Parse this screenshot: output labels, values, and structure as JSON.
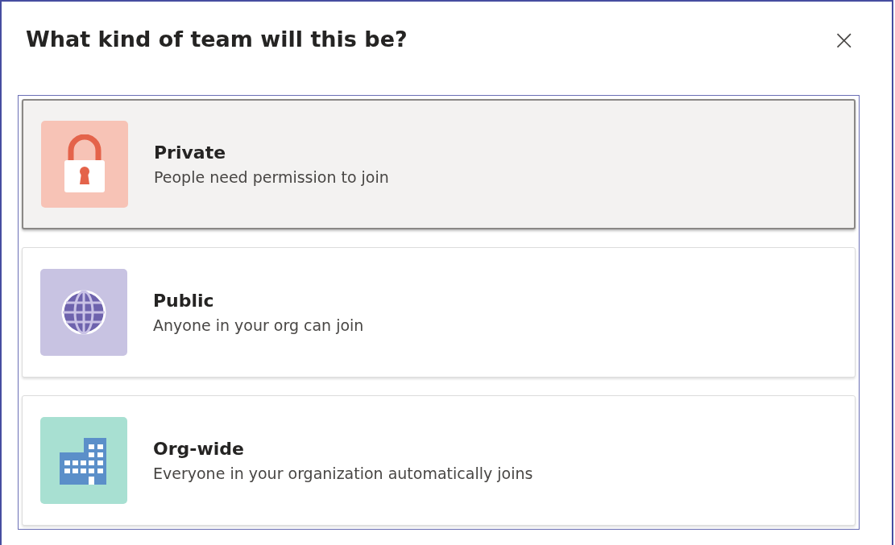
{
  "dialog": {
    "title": "What kind of team will this be?",
    "close_label": "×"
  },
  "options": [
    {
      "kind": "lock",
      "title": "Private",
      "description": "People need permission to join",
      "selected": true
    },
    {
      "kind": "globe",
      "title": "Public",
      "description": "Anyone in your org can join",
      "selected": false
    },
    {
      "kind": "building",
      "title": "Org-wide",
      "description": "Everyone in your organization automatically joins",
      "selected": false
    }
  ]
}
